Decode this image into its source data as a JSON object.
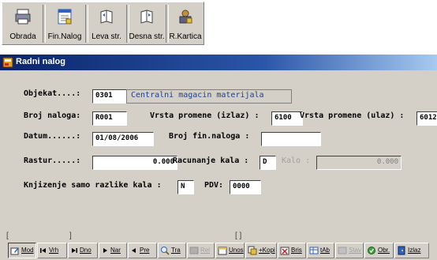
{
  "toolbar": {
    "buttons": [
      {
        "label": "Obrada",
        "icon": "printer-icon"
      },
      {
        "label": "Fin.Nalog",
        "icon": "document-icon"
      },
      {
        "label": "Leva str.",
        "icon": "left-page-icon"
      },
      {
        "label": "Desna str.",
        "icon": "right-page-icon"
      },
      {
        "label": "R.Kartica",
        "icon": "card-report-icon"
      }
    ]
  },
  "window": {
    "title": "Radni nalog",
    "icon": "form-window-icon"
  },
  "form": {
    "objekat": {
      "label": "Objekat....:",
      "code": "0301",
      "description": "Centralni magacin materijala"
    },
    "broj_naloga": {
      "label": "Broj naloga:",
      "value": "R001"
    },
    "vrsta_izlaz": {
      "label": "Vrsta promene (izlaz) :",
      "value": "6100"
    },
    "vrsta_ulaz": {
      "label": "Vrsta promene (ulaz) :",
      "value": "6012"
    },
    "datum": {
      "label": "Datum......:",
      "value": "01/08/2006"
    },
    "broj_fin_naloga": {
      "label": "Broj fin.naloga :",
      "value": ""
    },
    "rastur": {
      "label": "Rastur.....:",
      "value": "0.000"
    },
    "racunanje_kala": {
      "label": "Racunanje kala :",
      "value": "D"
    },
    "kalo": {
      "label": "Kalo :",
      "value": "0.000"
    },
    "knjizenje": {
      "label": "Knjizenje samo razlike kala :",
      "value": "N"
    },
    "pdv": {
      "label": "PDV:",
      "value": "0000"
    }
  },
  "navbar": {
    "buttons": [
      {
        "label": "Mod",
        "icon": "edit-icon",
        "enabled": true
      },
      {
        "label": "Vrh",
        "icon": "first-record-icon",
        "enabled": true
      },
      {
        "label": "Dno",
        "icon": "last-record-icon",
        "enabled": true
      },
      {
        "label": "Nar",
        "icon": "next-icon",
        "enabled": true
      },
      {
        "label": "Pre",
        "icon": "previous-icon",
        "enabled": true
      },
      {
        "label": "Tra",
        "icon": "search-icon",
        "enabled": true
      },
      {
        "label": "Rel",
        "icon": "relation-icon",
        "enabled": false
      },
      {
        "label": "Unos",
        "icon": "new-record-icon",
        "enabled": true
      },
      {
        "label": "+Kopi",
        "icon": "copy-icon",
        "enabled": true
      },
      {
        "label": "Bris",
        "icon": "delete-icon",
        "enabled": true
      },
      {
        "label": "tAb",
        "icon": "table-icon",
        "enabled": true
      },
      {
        "label": "Stav",
        "icon": "items-icon",
        "enabled": false
      },
      {
        "label": "Obr.",
        "icon": "process-icon",
        "enabled": true
      },
      {
        "label": "Izlaz",
        "icon": "exit-icon",
        "enabled": true
      }
    ]
  },
  "colors": {
    "titlebar_start": "#0a246a",
    "titlebar_end": "#a6caf0",
    "form_bg": "#d4d0c8",
    "description_text": "#1f3f8f"
  }
}
